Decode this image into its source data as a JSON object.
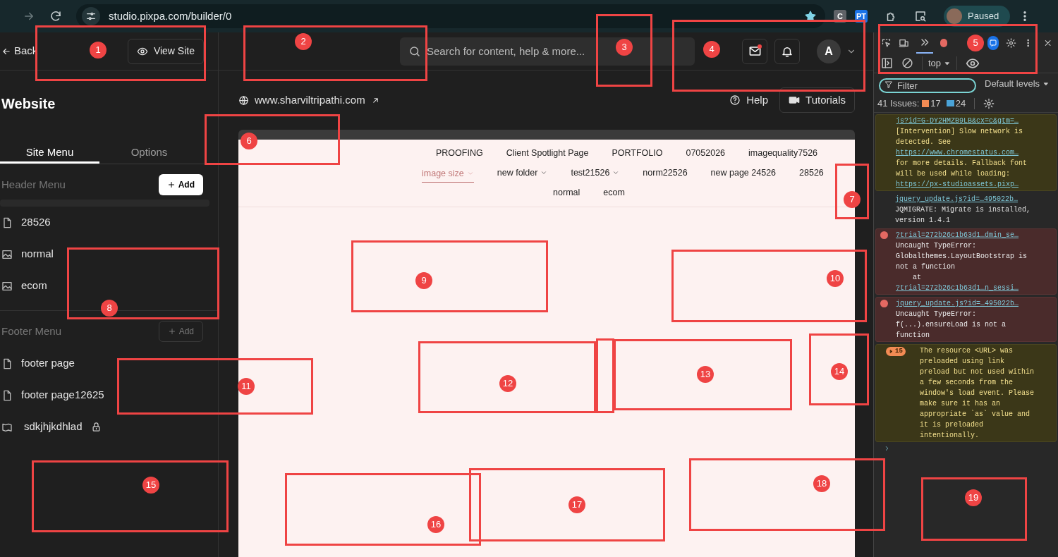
{
  "browser": {
    "url": "studio.pixpa.com/builder/0",
    "extensions": [
      {
        "label": "C",
        "color": "#5f6368"
      },
      {
        "label": "PT",
        "color": "#1a73e8"
      }
    ],
    "profile": {
      "status": "Paused"
    }
  },
  "sidebar": {
    "back": "Back",
    "view_site": "View Site",
    "title": "Website",
    "tabs": [
      {
        "label": "Site Menu",
        "selected": true
      },
      {
        "label": "Options",
        "selected": false
      }
    ],
    "sections": [
      {
        "title": "Header Menu",
        "add": "Add",
        "kind": "filled",
        "items": [
          {
            "label": "28526",
            "kind": "page",
            "locked": false
          },
          {
            "label": "normal",
            "kind": "gallery",
            "locked": false
          },
          {
            "label": "ecom",
            "kind": "gallery",
            "locked": false
          }
        ]
      },
      {
        "title": "Footer Menu",
        "add": "Add",
        "kind": "outline",
        "items": [
          {
            "label": "footer page",
            "kind": "page",
            "locked": false
          },
          {
            "label": "footer page12625",
            "kind": "page",
            "locked": false
          },
          {
            "label": "sdkjhjkdhlad",
            "kind": "folder",
            "locked": true
          }
        ]
      }
    ]
  },
  "topbar": {
    "search_placeholder": "Search for content, help & more...",
    "mail_unread": true,
    "avatar": "A"
  },
  "site_bar": {
    "url": "www.sharviltripathi.com",
    "help": "Help",
    "tutorials": "Tutorials"
  },
  "preview": {
    "nav_rows": [
      [
        {
          "label": "PROOFING",
          "dropdown": false,
          "selected": false
        },
        {
          "label": "Client Spotlight Page",
          "dropdown": false,
          "selected": false
        },
        {
          "label": "PORTFOLIO",
          "dropdown": false,
          "selected": false
        },
        {
          "label": "07052026",
          "dropdown": false,
          "selected": false
        },
        {
          "label": "imagequality7526",
          "dropdown": false,
          "selected": false
        }
      ],
      [
        {
          "label": "image size",
          "dropdown": true,
          "selected": true
        },
        {
          "label": "new folder",
          "dropdown": true,
          "selected": false
        },
        {
          "label": "test21526",
          "dropdown": true,
          "selected": false
        },
        {
          "label": "norm22526",
          "dropdown": false,
          "selected": false
        },
        {
          "label": "new page 24526",
          "dropdown": false,
          "selected": false
        },
        {
          "label": "28526",
          "dropdown": false,
          "selected": false
        }
      ],
      [
        {
          "label": "normal",
          "dropdown": false,
          "selected": false
        },
        {
          "label": "ecom",
          "dropdown": false,
          "selected": false
        }
      ]
    ]
  },
  "devtools": {
    "context": "top",
    "filter_placeholder": "Filter",
    "levels": "Default levels",
    "issues": {
      "label": "41 Issues:",
      "warnings": "17",
      "info": "24"
    },
    "messages": [
      {
        "kind": "warning",
        "source": "js?id=G-DY2HMZB9LB&cx=c&gtm=…",
        "parts": [
          {
            "text": "[Intervention] Slow network is detected. See ",
            "link": false
          },
          {
            "text": "https://www.chromestatus.com…",
            "link": true
          },
          {
            "text": " for more details. Fallback font will be used while loading: ",
            "link": false
          },
          {
            "text": "https://px-studioassets.pixp…",
            "link": true
          }
        ]
      },
      {
        "kind": "info",
        "source": "jquery_update.js?id=…495022b…",
        "parts": [
          {
            "text": "JQMIGRATE: Migrate is installed, version 1.4.1",
            "link": false
          }
        ]
      },
      {
        "kind": "error",
        "source": "?trial=272b26c1b63d1…dmin_se…",
        "parts": [
          {
            "text": "Uncaught TypeError: Globalthemes.LayoutBootstrap is not a function\n    at ",
            "link": false
          },
          {
            "text": "?trial=272b26c1b63d1…n_sessi…",
            "link": true
          }
        ]
      },
      {
        "kind": "error",
        "source": "jquery_update.js?id=…495022b…",
        "parts": [
          {
            "text": "Uncaught TypeError: f(...).ensureLoad is not a function",
            "link": false
          }
        ]
      },
      {
        "kind": "warning",
        "count": "15",
        "parts": [
          {
            "text": "The resource <URL> was preloaded using link preload but not used within a few seconds from the window's load event. Please make sure it has an appropriate `as` value and it is preloaded intentionally.",
            "link": false
          }
        ]
      }
    ]
  },
  "annotations": [
    {
      "label": "1"
    },
    {
      "label": "2"
    },
    {
      "label": "3"
    },
    {
      "label": "4"
    },
    {
      "label": "5"
    },
    {
      "label": "6"
    },
    {
      "label": "7"
    },
    {
      "label": "8"
    },
    {
      "label": "9"
    },
    {
      "label": "10"
    },
    {
      "label": "11"
    },
    {
      "label": "12"
    },
    {
      "label": "13"
    },
    {
      "label": "14"
    },
    {
      "label": "15"
    },
    {
      "label": "16"
    },
    {
      "label": "17"
    },
    {
      "label": "18"
    },
    {
      "label": "19"
    }
  ]
}
